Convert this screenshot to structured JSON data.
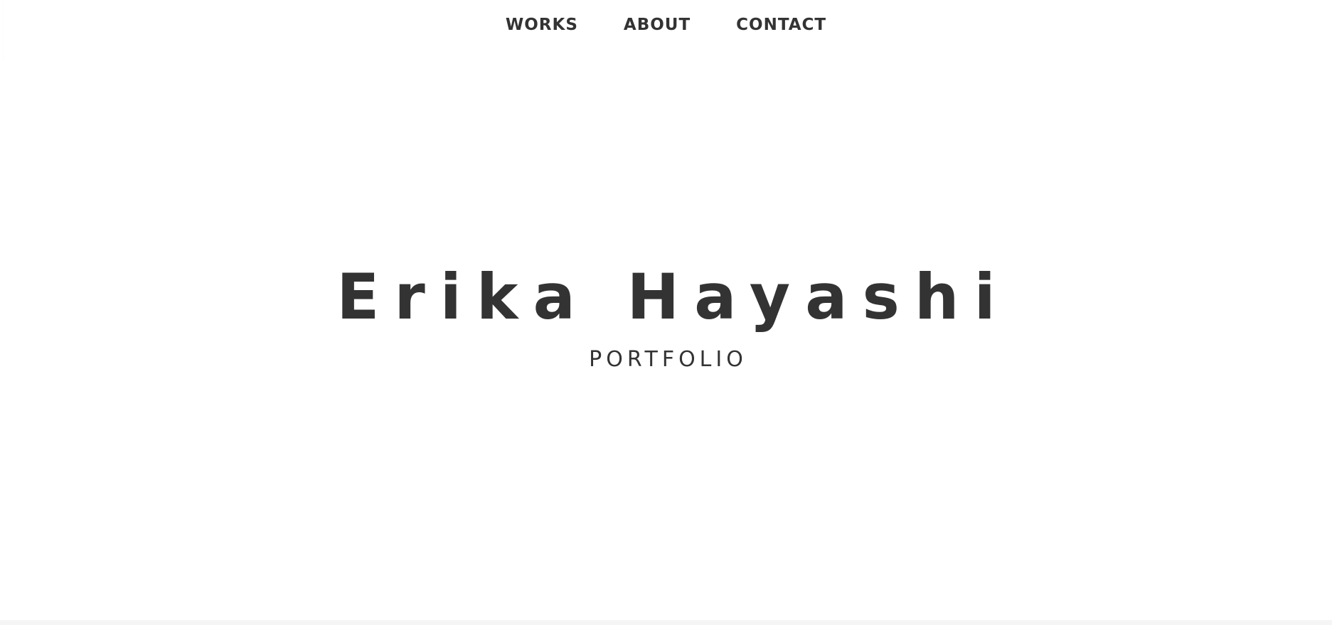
{
  "nav": {
    "items": [
      {
        "label": "WORKS"
      },
      {
        "label": "ABOUT"
      },
      {
        "label": "CONTACT"
      }
    ]
  },
  "hero": {
    "title": "Erika Hayashi",
    "subtitle": "PORTFOLIO"
  },
  "colors": {
    "text": "#333333",
    "background": "#ffffff",
    "header_border": "#e6e6e6",
    "footer_strip": "#f5f5f5"
  }
}
